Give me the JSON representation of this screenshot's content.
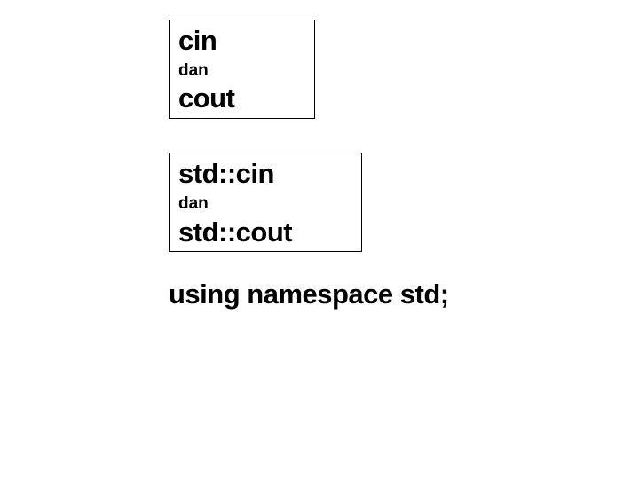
{
  "box1": {
    "line1": "cin",
    "label": "dan",
    "line2": "cout"
  },
  "box2": {
    "line1": "std::cin",
    "label": "dan",
    "line2": "std::cout"
  },
  "footer": "using namespace std;"
}
